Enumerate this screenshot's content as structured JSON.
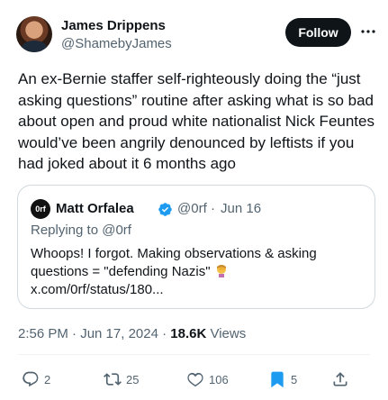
{
  "author": {
    "name": "James Drippens",
    "handle": "@ShamebyJames",
    "follow_label": "Follow"
  },
  "tweet": {
    "text": "An ex-Bernie staffer self-righteously doing the “just asking questions” routine after asking what is so bad about open and proud white nationalist Nick Feuntes would’ve been angrily denounced by leftists if you had joked about it 6 months ago"
  },
  "quoted_tweet": {
    "avatar_text": "0rf",
    "name": "Matt Orfalea",
    "handle": "@0rf",
    "separator": "·",
    "date": "Jun 16",
    "replying_prefix": "Replying to ",
    "replying_to": "@0rf",
    "text": "Whoops! I forgot. Making observations & asking questions = \"defending Nazis\"",
    "link": "x.com/0rf/status/180..."
  },
  "meta": {
    "time_date": "2:56 PM · Jun 17, 2024 · ",
    "views_count": "18.6K",
    "views_label": " Views"
  },
  "actions": {
    "replies": "2",
    "reposts": "25",
    "likes": "106",
    "bookmarks": "5"
  },
  "colors": {
    "text": "#0f1419",
    "muted": "#536471",
    "verified": "#1d9bf0",
    "bookmark_active": "#1d9bf0",
    "follow_bg": "#0f1419"
  },
  "icons": [
    "more-icon",
    "verified-icon",
    "facepalm-emoji-icon",
    "reply-icon",
    "repost-icon",
    "like-icon",
    "bookmark-icon",
    "share-icon"
  ]
}
